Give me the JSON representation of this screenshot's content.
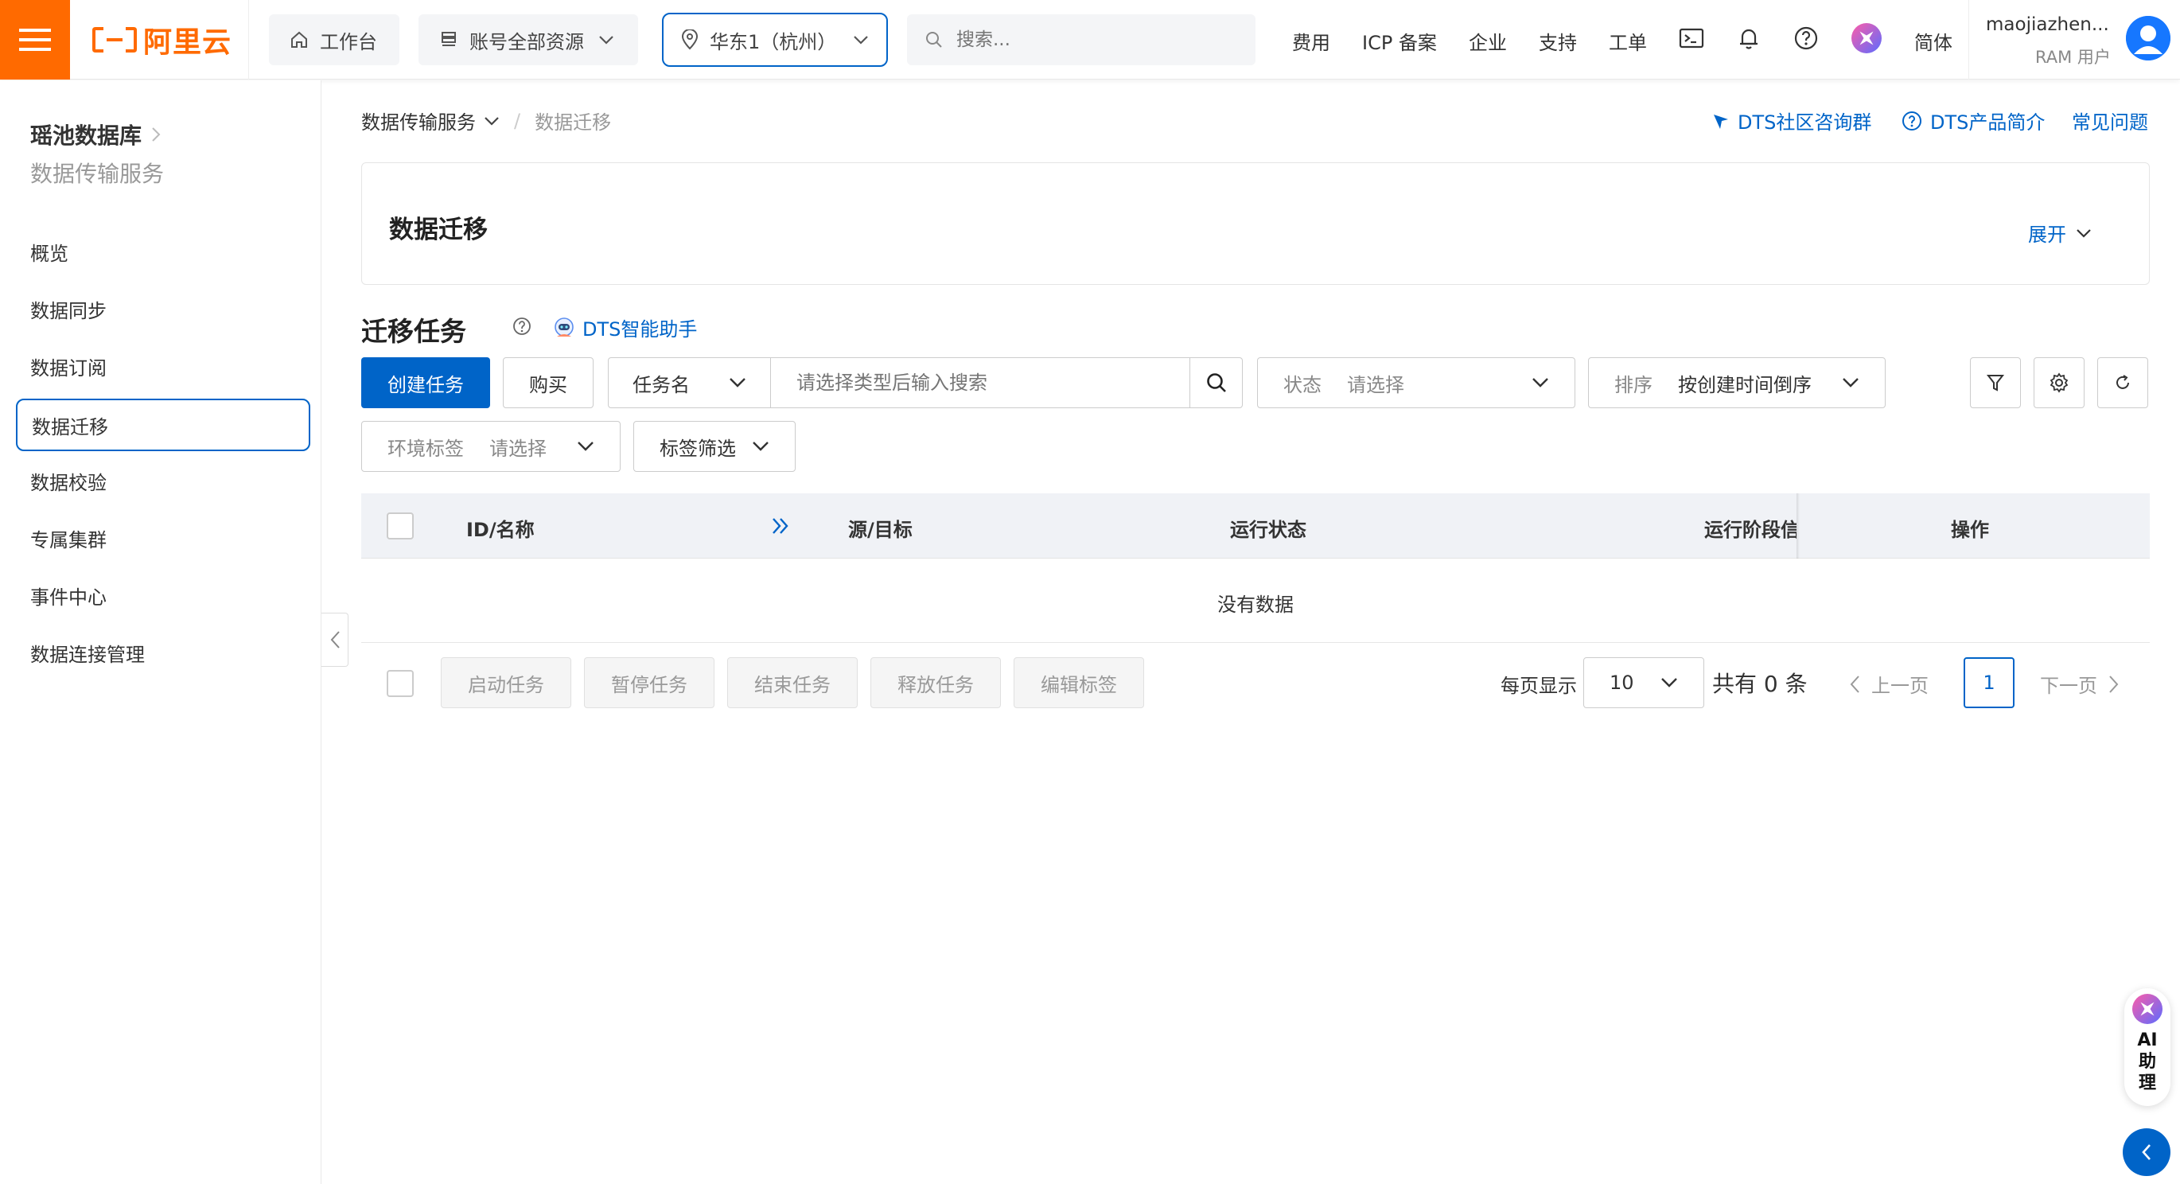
{
  "topbar": {
    "logo_text": "阿里云",
    "workbench": "工作台",
    "resources": "账号全部资源",
    "region": "华东1（杭州）",
    "search_placeholder": "搜索...",
    "links": [
      "费用",
      "ICP 备案",
      "企业",
      "支持",
      "工单"
    ],
    "lang": "简体",
    "user_name": "maojiazhen...",
    "user_role": "RAM 用户",
    "icons": [
      "terminal-icon",
      "bell-icon",
      "help-icon",
      "ai-star-icon"
    ]
  },
  "sidebar": {
    "product": "瑶池数据库",
    "subproduct": "数据传输服务",
    "items": [
      {
        "label": "概览"
      },
      {
        "label": "数据同步"
      },
      {
        "label": "数据订阅"
      },
      {
        "label": "数据迁移",
        "active": true
      },
      {
        "label": "数据校验"
      },
      {
        "label": "专属集群"
      },
      {
        "label": "事件中心"
      },
      {
        "label": "数据连接管理"
      }
    ]
  },
  "breadcrumb": {
    "root": "数据传输服务",
    "sep": "/",
    "current": "数据迁移"
  },
  "header_links": {
    "community": "DTS社区咨询群",
    "intro": "DTS产品简介",
    "faq": "常见问题"
  },
  "info_card": {
    "title": "数据迁移",
    "expand": "展开"
  },
  "section": {
    "title": "迁移任务",
    "assistant": "DTS智能助手"
  },
  "toolbar": {
    "create": "创建任务",
    "buy": "购买",
    "filter_type": "任务名",
    "filter_placeholder": "请选择类型后输入搜索",
    "status_label": "状态",
    "status_placeholder": "请选择",
    "sort_label": "排序",
    "sort_value": "按创建时间倒序",
    "env_label": "环境标签",
    "env_placeholder": "请选择",
    "tag_filter": "标签筛选"
  },
  "table": {
    "columns": [
      "ID/名称",
      "源/目标",
      "运行状态",
      "运行阶段信",
      "操作"
    ],
    "empty": "没有数据"
  },
  "bulk_actions": [
    "启动任务",
    "暂停任务",
    "结束任务",
    "释放任务",
    "编辑标签"
  ],
  "pagination": {
    "page_size_label": "每页显示",
    "page_size": "10",
    "total": "共有 0 条",
    "prev": "上一页",
    "current": "1",
    "next": "下一页"
  },
  "ai_float": {
    "label": "AI助理"
  },
  "colors": {
    "brand_orange": "#ff6a00",
    "primary_blue": "#0064c8"
  }
}
